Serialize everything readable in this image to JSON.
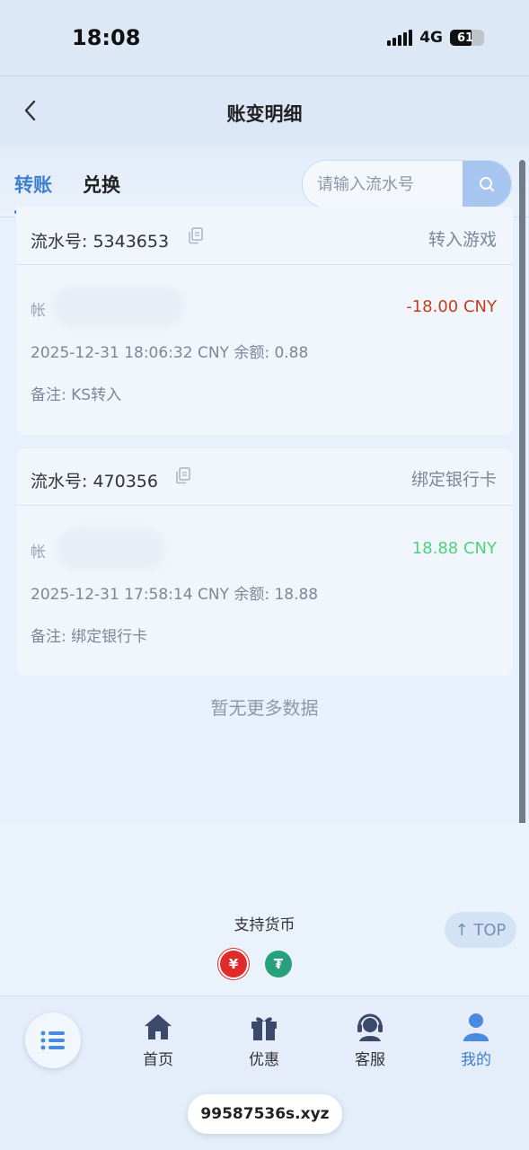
{
  "status_bar": {
    "time": "18:08",
    "network": "4G",
    "battery": "61"
  },
  "header": {
    "title": "账变明细"
  },
  "tabs": [
    {
      "label": "转账",
      "active": true
    },
    {
      "label": "兑换",
      "active": false
    }
  ],
  "search": {
    "placeholder": "请输入流水号"
  },
  "records": [
    {
      "serial": "流水号: 5343653",
      "type": "转入游戏",
      "account_label": "帐",
      "amount": "-18.00 CNY",
      "time_balance": "2025-12-31 18:06:32 CNY 余额: 0.88",
      "remark": "备注: KS转入"
    },
    {
      "serial": "流水号: 470356",
      "type": "绑定银行卡",
      "account_label": "帐",
      "amount": "18.88 CNY",
      "time_balance": "2025-12-31 17:58:14 CNY 余额: 18.88",
      "remark": "备注: 绑定银行卡"
    }
  ],
  "no_more": "暂无更多数据",
  "footer": {
    "currency_title": "支持货币",
    "currencies": [
      {
        "symbol": "¥",
        "icon": "cny-icon"
      },
      {
        "symbol": "₮",
        "icon": "usdt-icon"
      }
    ],
    "top_label": "↑ TOP"
  },
  "bottom_nav": [
    {
      "label": "首页",
      "icon": "home-icon"
    },
    {
      "label": "优惠",
      "icon": "gift-icon"
    },
    {
      "label": "客服",
      "icon": "support-icon"
    },
    {
      "label": "我的",
      "icon": "user-icon",
      "active": true
    }
  ],
  "domain": "99587536s.xyz",
  "colors": {
    "accent": "#3e7fd0",
    "negative": "#c2411d",
    "positive": "#4dd27c"
  }
}
